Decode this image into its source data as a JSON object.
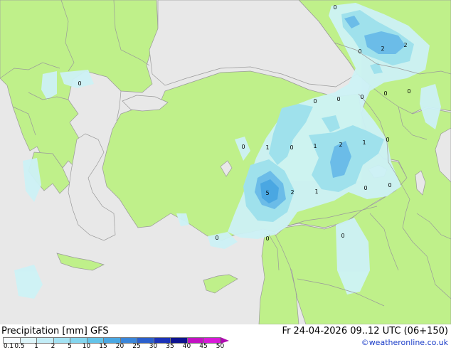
{
  "footer": {
    "title": "Precipitation [mm]  GFS",
    "run_info": "Fr 24-04-2026 09..12 UTC (06+150)",
    "credit": "©weatheronline.co.uk"
  },
  "legend": {
    "ticks": [
      "0.1",
      "0.5",
      "1",
      "2",
      "5",
      "10",
      "15",
      "20",
      "25",
      "30",
      "35",
      "40",
      "45",
      "50"
    ],
    "colors": [
      "#f5fbff",
      "#ddf5fa",
      "#c3edf7",
      "#a3e2f3",
      "#84d5ee",
      "#63c3e8",
      "#4aa7e2",
      "#3a86da",
      "#2b5fcc",
      "#1c33b8",
      "#0d1390",
      "#c212c2",
      "#d81ad8",
      "#b00bb0"
    ]
  },
  "map": {
    "colors": {
      "sea": "#e8e8e8",
      "land": "#bff08a",
      "precip_light": "#cdf2f6",
      "precip_mid": "#9fe1ec",
      "precip_heavy": "#6bbce8",
      "border": "#9a9a9a"
    },
    "value_labels": [
      "0",
      "0",
      "0",
      "2",
      "2",
      "0",
      "0",
      "0",
      "0",
      "0",
      "1",
      "0",
      "1",
      "2",
      "1",
      "0",
      "0",
      "5",
      "2",
      "1",
      "0",
      "0",
      "0",
      "0",
      "0"
    ]
  }
}
